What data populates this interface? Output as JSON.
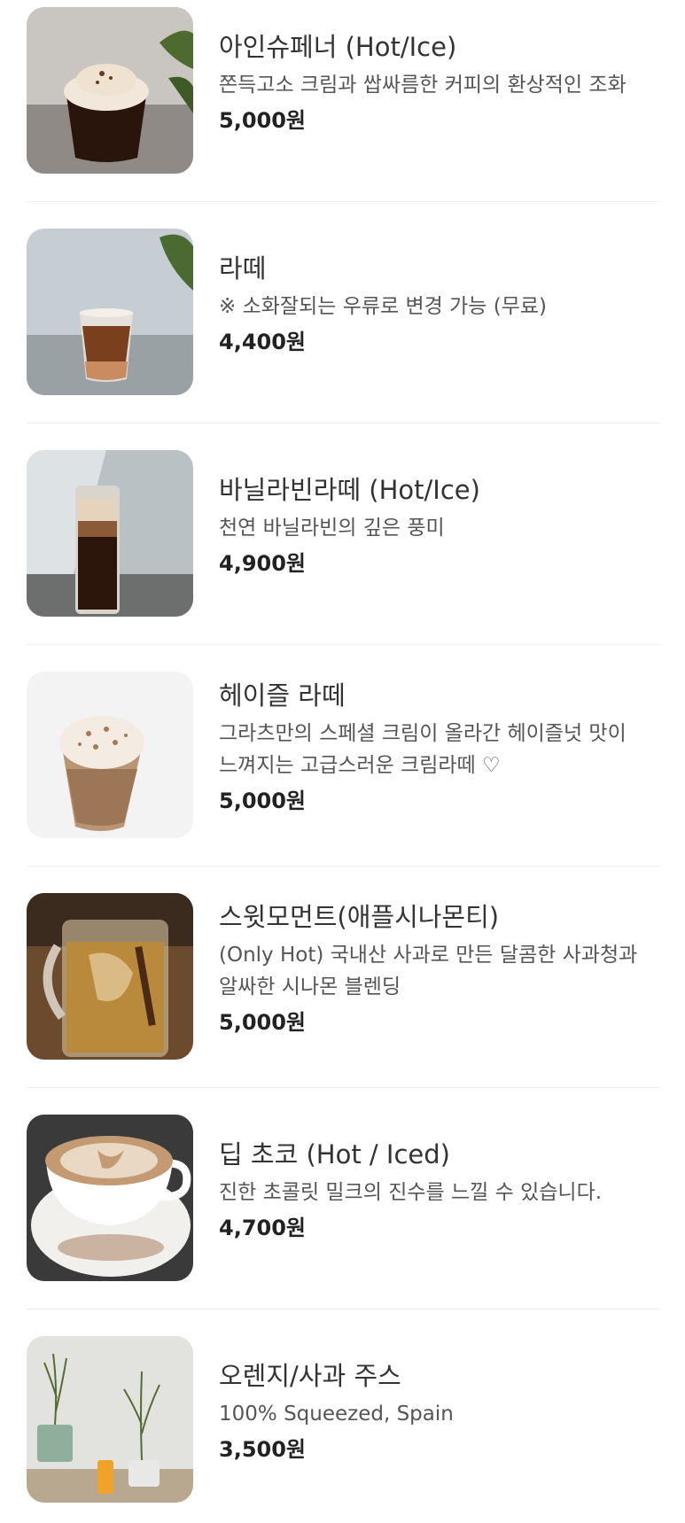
{
  "menu": {
    "items": [
      {
        "name": "아인슈페너 (Hot/Ice)",
        "desc_lines": [
          "쫀득고소 크림과 쌉싸름한 커피의 환상적인 조화"
        ],
        "price": "5,000원",
        "image": "einspanner-photo"
      },
      {
        "name": "라떼",
        "desc_lines": [
          "※ 소화잘되는 우류로 변경 가능 (무료)"
        ],
        "price": "4,400원",
        "image": "latte-photo"
      },
      {
        "name": "바닐라빈라떼 (Hot/Ice)",
        "desc_lines": [
          "천연 바닐라빈의 깊은 풍미"
        ],
        "price": "4,900원",
        "image": "vanilla-latte-photo"
      },
      {
        "name": "헤이즐 라떼",
        "desc_lines": [
          "그라츠만의 스페셜 크림이 올라간 헤이즐넛 맛이",
          "느껴지는 고급스러운 크림라떼 ♡"
        ],
        "price": "5,000원",
        "image": "hazel-latte-photo"
      },
      {
        "name": "스윗모먼트(애플시나몬티)",
        "desc_lines": [
          "(Only Hot) 국내산 사과로 만든 달콤한 사과청과",
          "알싸한 시나몬 블렌딩"
        ],
        "price": "5,000원",
        "image": "apple-cinnamon-tea-photo"
      },
      {
        "name": "딥 초코 (Hot / Iced)",
        "desc_lines": [
          "진한 초콜릿 밀크의 진수를 느낄 수 있습니다."
        ],
        "price": "4,700원",
        "image": "deep-choco-photo"
      },
      {
        "name": "오렌지/사과 주스",
        "desc_lines": [
          "100% Squeezed, Spain"
        ],
        "price": "3,500원",
        "image": "juice-photo"
      }
    ]
  }
}
